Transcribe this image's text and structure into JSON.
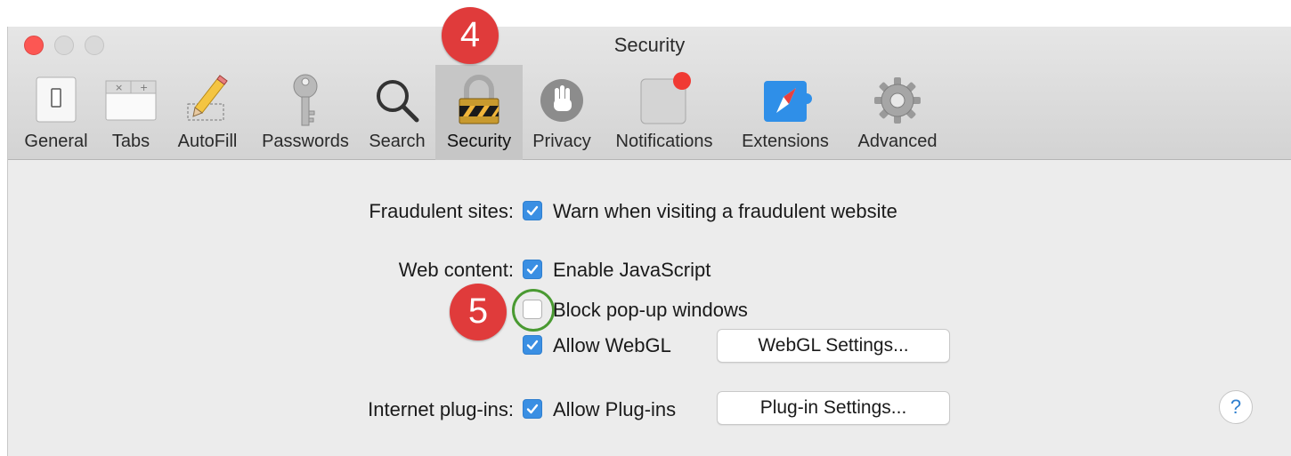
{
  "window": {
    "title": "Security"
  },
  "toolbar": {
    "tabs": [
      {
        "label": "General",
        "icon": "general-switch-icon"
      },
      {
        "label": "Tabs",
        "icon": "tabs-icon"
      },
      {
        "label": "AutoFill",
        "icon": "pencil-icon"
      },
      {
        "label": "Passwords",
        "icon": "key-icon"
      },
      {
        "label": "Search",
        "icon": "magnifier-icon"
      },
      {
        "label": "Security",
        "icon": "lock-icon",
        "selected": true
      },
      {
        "label": "Privacy",
        "icon": "hand-icon"
      },
      {
        "label": "Notifications",
        "icon": "notification-badge-icon"
      },
      {
        "label": "Extensions",
        "icon": "puzzle-compass-icon"
      },
      {
        "label": "Advanced",
        "icon": "gear-icon"
      }
    ]
  },
  "annotations": {
    "step4": "4",
    "step5": "5",
    "accent": "#e03b3b",
    "highlight_ring": "#4a9a32"
  },
  "security": {
    "fraudulent": {
      "label": "Fraudulent sites:",
      "option": "Warn when visiting a fraudulent website",
      "checked": true
    },
    "web_content": {
      "label": "Web content:",
      "javascript": {
        "text": "Enable JavaScript",
        "checked": true
      },
      "popups": {
        "text": "Block pop-up windows",
        "checked": false
      },
      "webgl": {
        "text": "Allow WebGL",
        "checked": true,
        "button": "WebGL Settings..."
      }
    },
    "plugins": {
      "label": "Internet plug-ins:",
      "option": "Allow Plug-ins",
      "checked": true,
      "button": "Plug-in Settings..."
    },
    "help": "?"
  },
  "colors": {
    "checkbox_on": "#3a8fe3",
    "selected_tab": "#c6c6c6"
  }
}
